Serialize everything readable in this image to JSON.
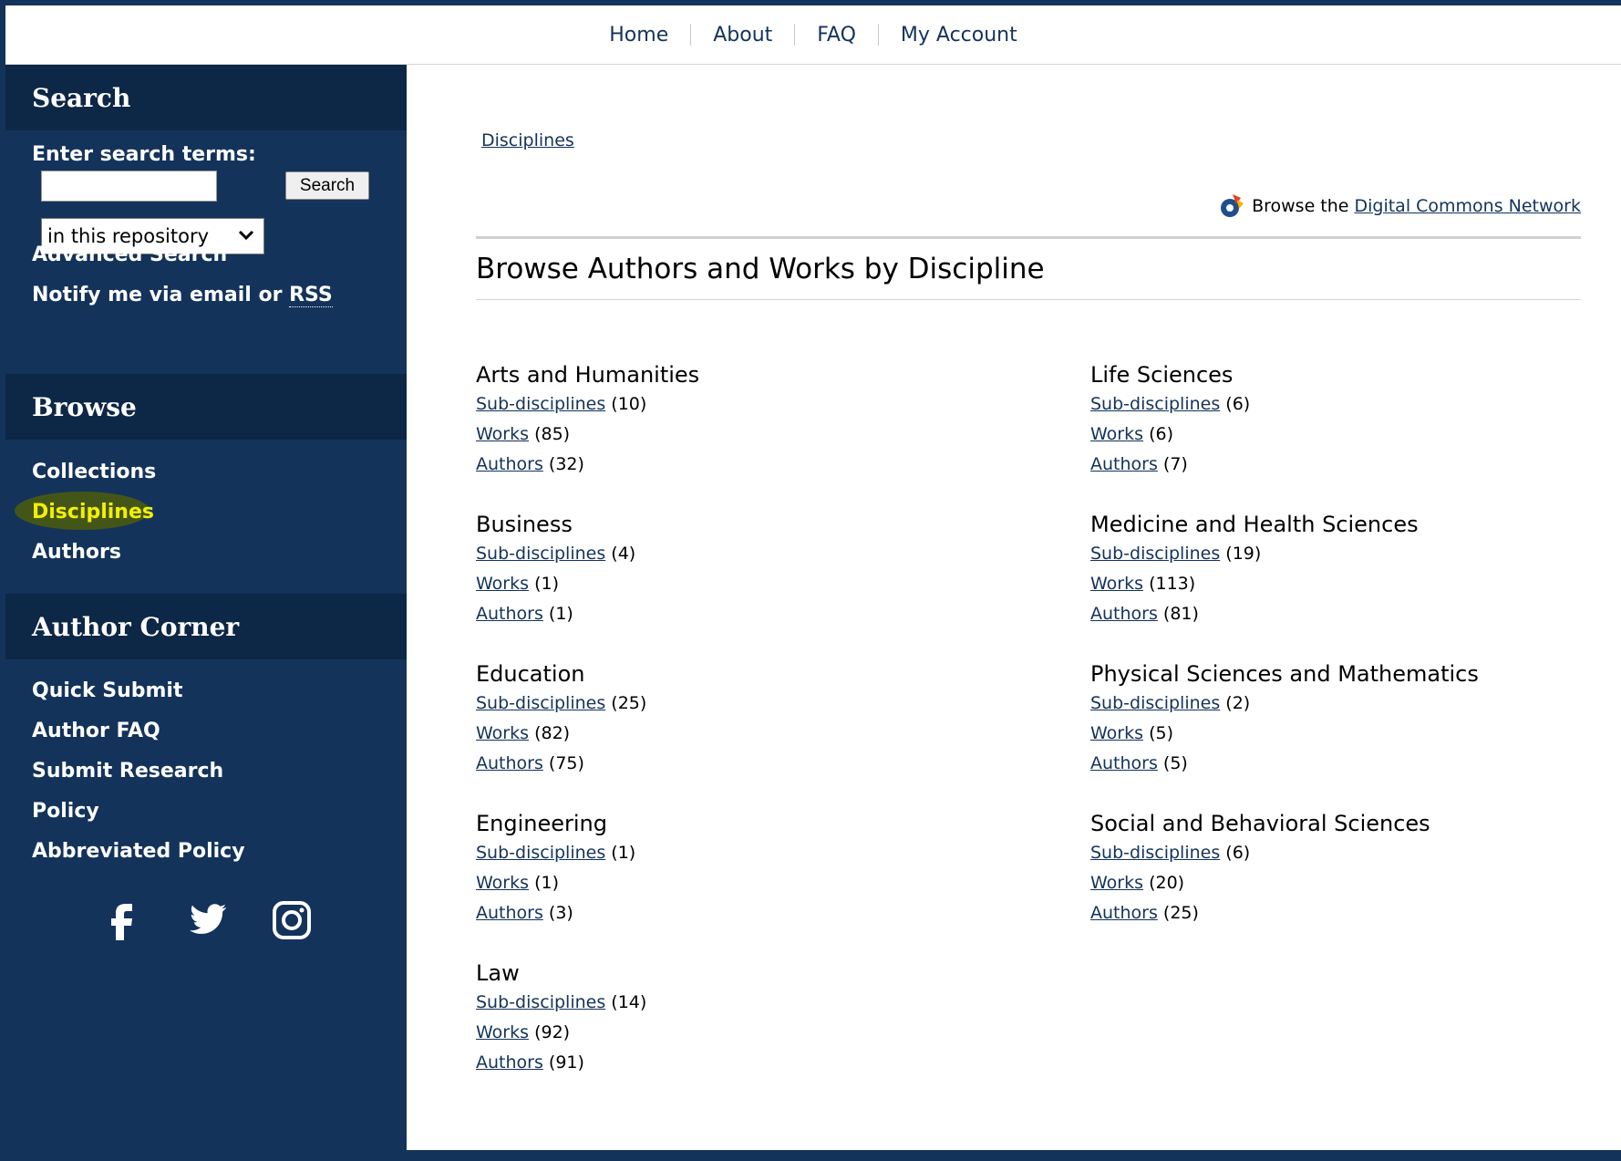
{
  "topnav": {
    "items": [
      "Home",
      "About",
      "FAQ",
      "My Account"
    ]
  },
  "sidebar": {
    "search": {
      "heading": "Search",
      "label": "Enter search terms:",
      "input_value": "",
      "button_label": "Search",
      "scope_selected": "in this repository",
      "advanced_link": "Advanced Search",
      "notify_text": "Notify me via email or ",
      "rss_link": "RSS"
    },
    "browse": {
      "heading": "Browse",
      "items": [
        "Collections",
        "Disciplines",
        "Authors"
      ],
      "highlighted": "Disciplines",
      "highlight_color": "#4a5a10"
    },
    "author_corner": {
      "heading": "Author Corner",
      "items": [
        "Quick Submit",
        "Author FAQ",
        "Submit Research",
        "Policy",
        "Abbreviated Policy"
      ]
    },
    "social": [
      "facebook-icon",
      "twitter-icon",
      "instagram-icon"
    ]
  },
  "main": {
    "breadcrumb": "Disciplines",
    "dcn_prefix": "Browse the",
    "dcn_link": "Digital Commons Network",
    "title": "Browse Authors and Works by Discipline",
    "link_labels": {
      "sub": "Sub-disciplines",
      "works": "Works",
      "authors": "Authors"
    },
    "disciplines": [
      {
        "name": "Arts and Humanities",
        "sub": "(10)",
        "works": "(85)",
        "authors": "(32)"
      },
      {
        "name": "Business",
        "sub": "(4)",
        "works": "(1)",
        "authors": "(1)"
      },
      {
        "name": "Education",
        "sub": "(25)",
        "works": "(82)",
        "authors": "(75)"
      },
      {
        "name": "Engineering",
        "sub": "(1)",
        "works": "(1)",
        "authors": "(3)"
      },
      {
        "name": "Law",
        "sub": "(14)",
        "works": "(92)",
        "authors": "(91)"
      },
      {
        "name": "Life Sciences",
        "sub": "(6)",
        "works": "(6)",
        "authors": "(7)"
      },
      {
        "name": "Medicine and Health Sciences",
        "sub": "(19)",
        "works": "(113)",
        "authors": "(81)"
      },
      {
        "name": "Physical Sciences and Mathematics",
        "sub": "(2)",
        "works": "(5)",
        "authors": "(5)"
      },
      {
        "name": "Social and Behavioral Sciences",
        "sub": "(6)",
        "works": "(20)",
        "authors": "(25)"
      }
    ]
  },
  "colors": {
    "navy": "#13335b",
    "navy_dark": "#0d2746"
  }
}
